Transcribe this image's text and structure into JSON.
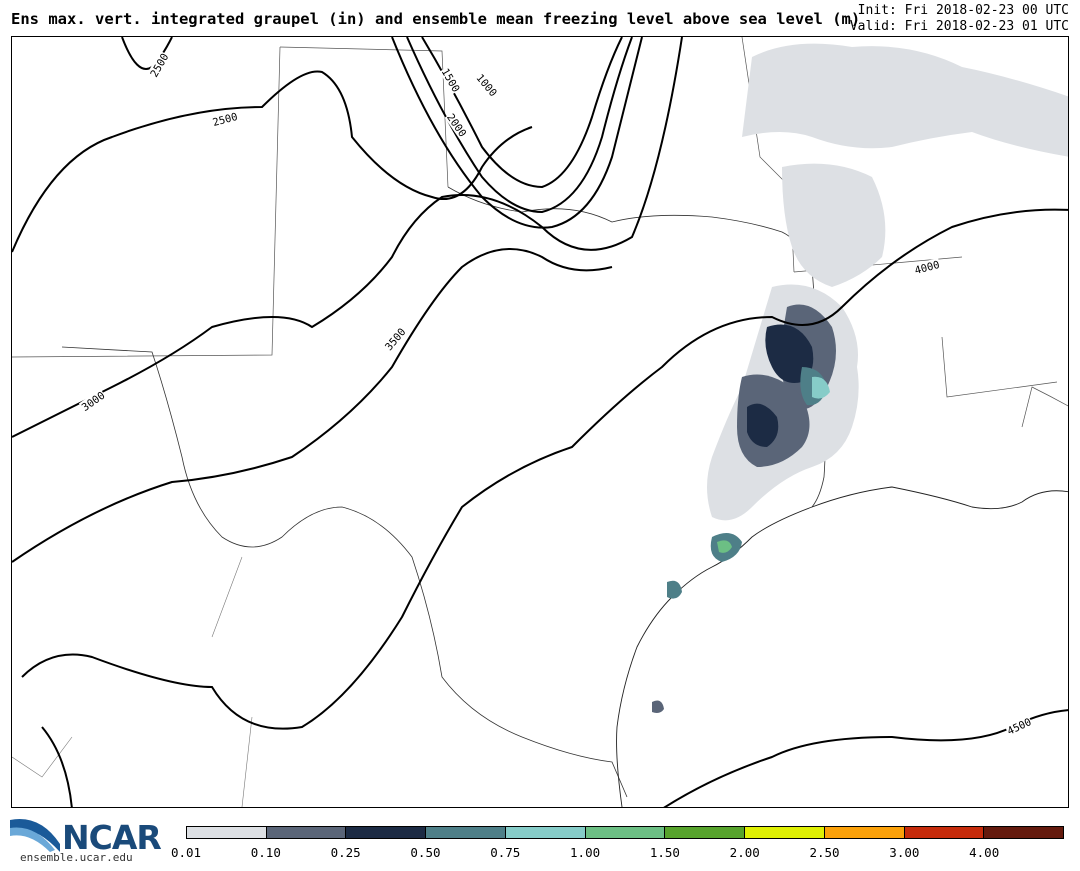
{
  "title": "Ens max. vert. integrated graupel (in) and ensemble mean freezing level above sea level (m)",
  "init_text": "Init: Fri 2018-02-23 00 UTC",
  "valid_text": "Valid: Fri 2018-02-23 01 UTC",
  "contour_labels": [
    "2500",
    "1000",
    "1500",
    "2000",
    "2500",
    "4000",
    "3500",
    "3000",
    "4500"
  ],
  "colorbar": {
    "labels": [
      "0.01",
      "0.10",
      "0.25",
      "0.50",
      "0.75",
      "1.00",
      "1.50",
      "2.00",
      "2.50",
      "3.00",
      "4.00"
    ],
    "colors": [
      "#dde0e4",
      "#5a6578",
      "#1c2b44",
      "#4e7f88",
      "#86ccc8",
      "#6cbf84",
      "#57a32c",
      "#dff004",
      "#fba10a",
      "#c62b0b",
      "#641a0d"
    ]
  },
  "logo": {
    "name": "NCAR",
    "url": "ensemble.ucar.edu"
  }
}
